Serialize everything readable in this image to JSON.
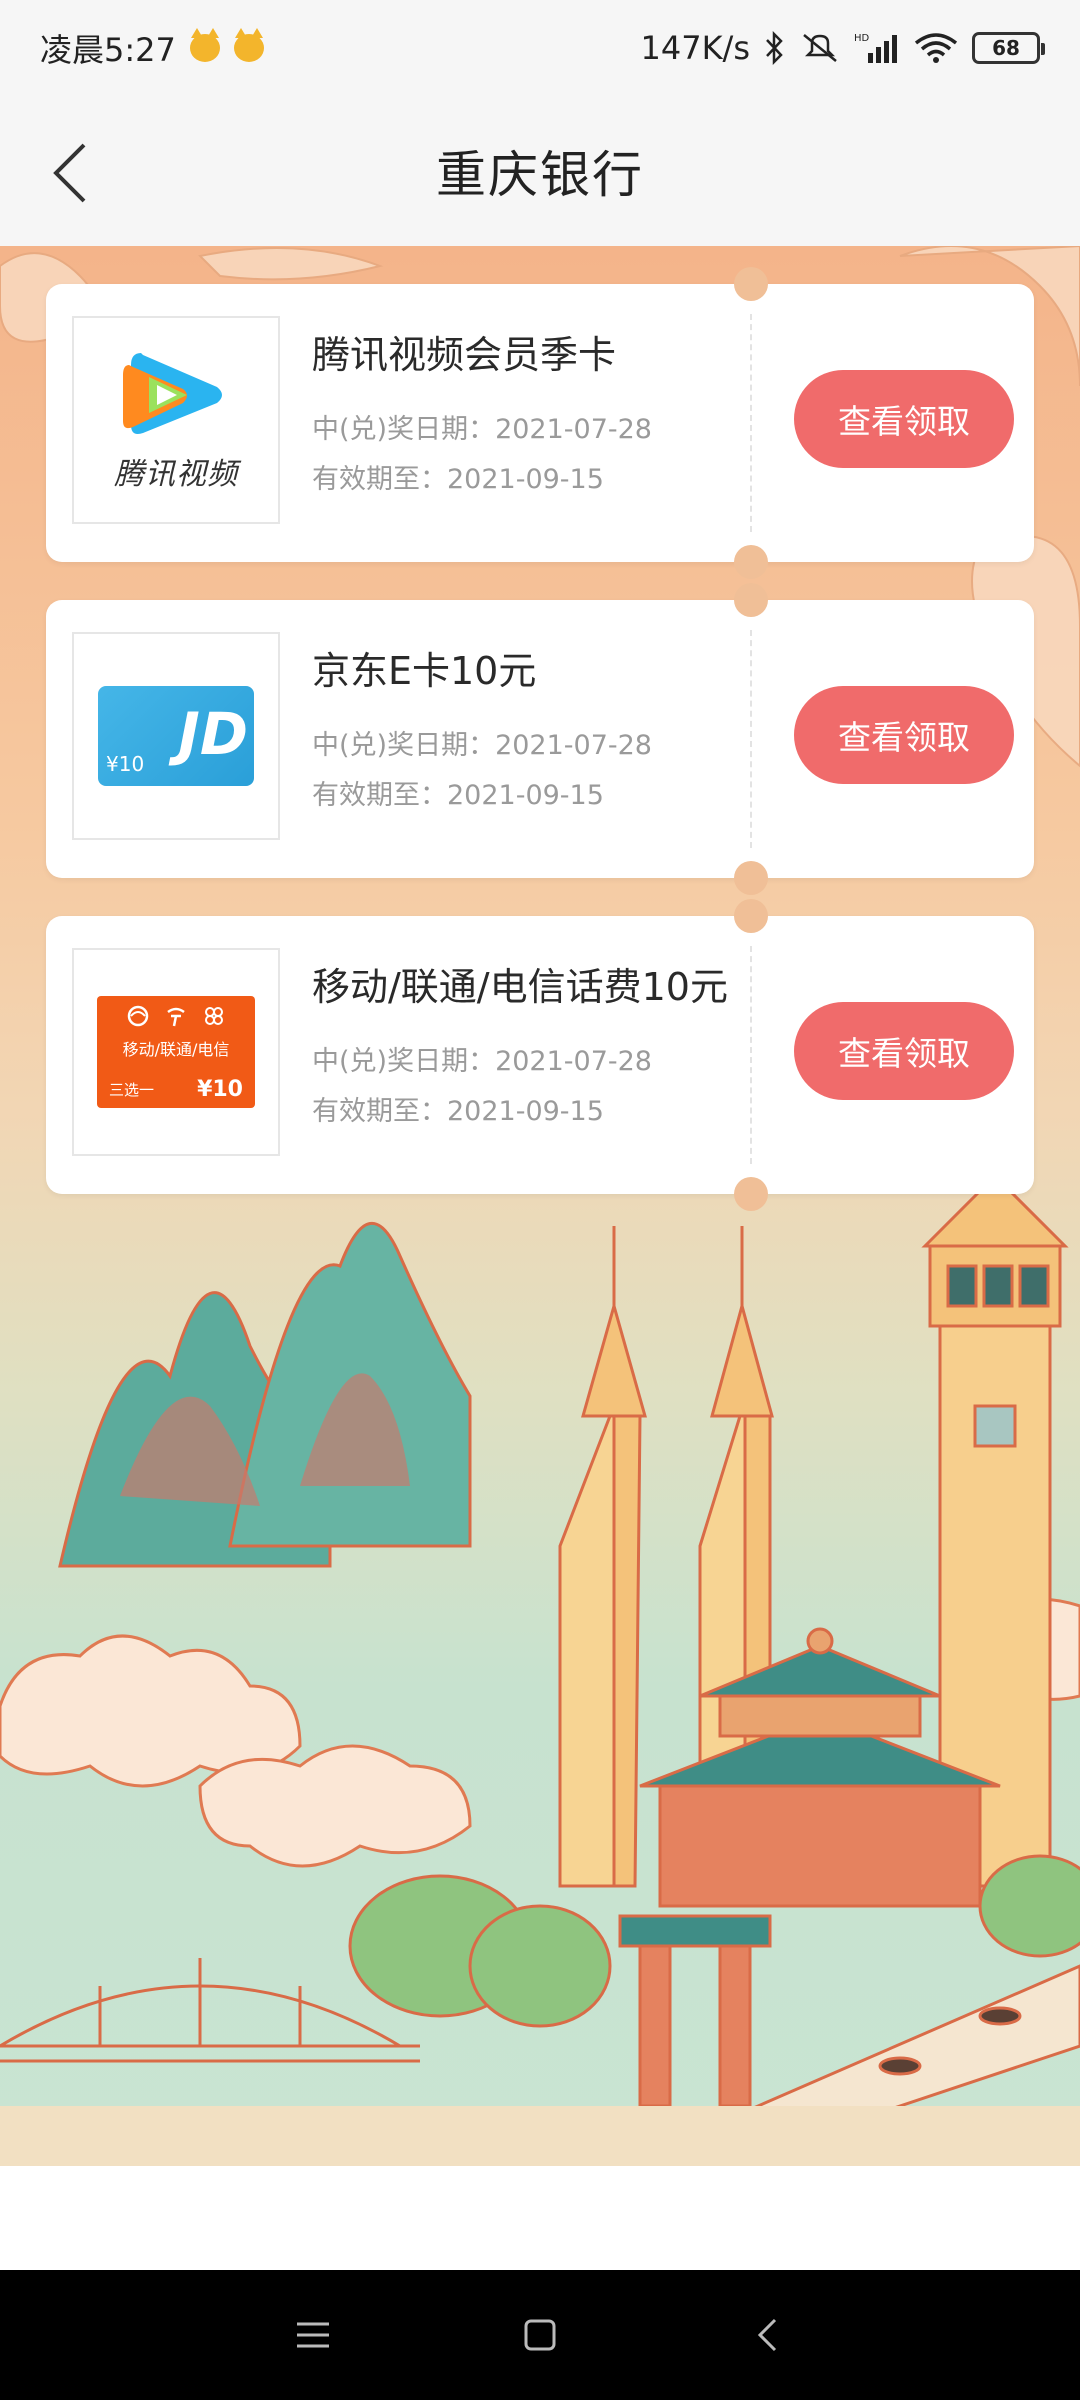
{
  "status_bar": {
    "time": "凌晨5:27",
    "network_speed": "147K/s",
    "battery": "68"
  },
  "header": {
    "title": "重庆银行",
    "back_icon": "chevron-left-icon"
  },
  "prizes": [
    {
      "name": "腾讯视频会员季卡",
      "win_date_label": "中(兑)奖日期：",
      "win_date": "2021-07-28",
      "valid_label": "有效期至：",
      "valid_until": "2021-09-15",
      "button_label": "查看领取",
      "thumb_text": "腾讯视频"
    },
    {
      "name": "京东E卡10元",
      "win_date_label": "中(兑)奖日期：",
      "win_date": "2021-07-28",
      "valid_label": "有效期至：",
      "valid_until": "2021-09-15",
      "button_label": "查看领取",
      "thumb_amount": "¥10",
      "thumb_mark": "JD"
    },
    {
      "name": "移动/联通/电信话费10元",
      "win_date_label": "中(兑)奖日期：",
      "win_date": "2021-07-28",
      "valid_label": "有效期至：",
      "valid_until": "2021-09-15",
      "button_label": "查看领取",
      "thumb_carriers": "移动/联通/电信",
      "thumb_pick": "三选一",
      "thumb_amount": "¥10"
    }
  ],
  "colors": {
    "accent_button": "#f06b6b",
    "bg_top": "#f4b48a",
    "bg_bottom": "#c9e4d2"
  }
}
